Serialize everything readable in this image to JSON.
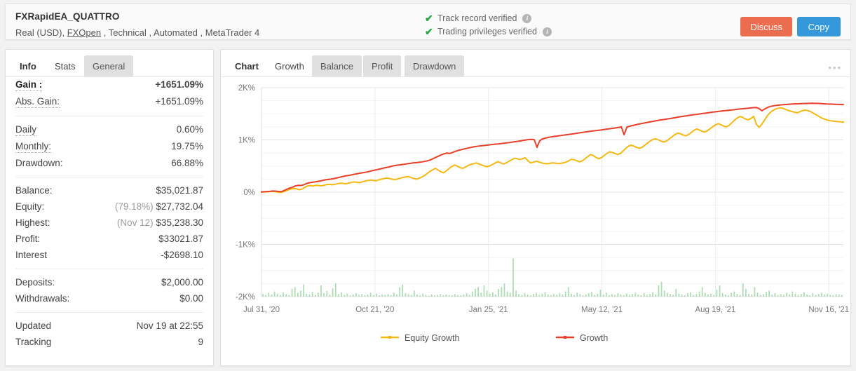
{
  "header": {
    "title": "FXRapidEA_QUATTRO",
    "subtitle_pre": "Real (USD), ",
    "broker_link": "FXOpen",
    "subtitle_post": " , Technical , Automated , MetaTrader 4",
    "verifications": [
      {
        "label": "Track record verified",
        "icon": "check-icon",
        "info": "i"
      },
      {
        "label": "Trading privileges verified",
        "icon": "check-icon",
        "info": "i"
      }
    ],
    "discuss_label": "Discuss",
    "copy_label": "Copy",
    "discuss_color": "#ec6c4f",
    "copy_color": "#3498db"
  },
  "left_panel": {
    "tabs": [
      {
        "label": "Info",
        "state": "plain"
      },
      {
        "label": "Stats",
        "state": "active"
      },
      {
        "label": "General",
        "state": "inactive"
      }
    ],
    "rows": [
      {
        "label": "Gain :",
        "value": "+1651.09%",
        "emphasis": "big",
        "color": "green-b"
      },
      {
        "label": "Abs. Gain:",
        "value": "+1651.09%",
        "emphasis": "",
        "color": "green"
      },
      {
        "label": "Daily",
        "value": "0.60%",
        "emphasis": "",
        "color": ""
      },
      {
        "label": "Monthly:",
        "value": "19.75%",
        "emphasis": "",
        "color": ""
      },
      {
        "label": "Drawdown:",
        "value": "66.88%",
        "emphasis": "",
        "color": ""
      },
      {
        "label": "Balance:",
        "value": "$35,021.87",
        "emphasis": "",
        "color": ""
      },
      {
        "label": "Equity:",
        "value": "$27,732.04",
        "prefix": "(79.18%)",
        "emphasis": "",
        "color": ""
      },
      {
        "label": "Highest:",
        "value": "$35,238.30",
        "prefix": "(Nov 12)",
        "emphasis": "",
        "color": ""
      },
      {
        "label": "Profit:",
        "value": "$33021.87",
        "emphasis": "",
        "color": "green"
      },
      {
        "label": "Interest",
        "value": "-$2698.10",
        "emphasis": "",
        "color": ""
      },
      {
        "label": "Deposits:",
        "value": "$2,000.00",
        "emphasis": "",
        "color": ""
      },
      {
        "label": "Withdrawals:",
        "value": "$0.00",
        "emphasis": "",
        "color": ""
      },
      {
        "label": "Updated",
        "value": "Nov 19 at 22:55",
        "emphasis": "",
        "color": "",
        "nounder": true
      },
      {
        "label": "Tracking",
        "value": "9",
        "emphasis": "",
        "color": "",
        "nounder": true
      }
    ]
  },
  "right_panel": {
    "title": "Chart",
    "tabs": [
      {
        "label": "Growth",
        "state": "active"
      },
      {
        "label": "Balance",
        "state": "inactive"
      },
      {
        "label": "Profit",
        "state": "inactive"
      },
      {
        "label": "Drawdown",
        "state": "inactive"
      }
    ],
    "menu_icon": "•••"
  },
  "chart_data": {
    "type": "line",
    "title": "Growth",
    "xlabel": "",
    "ylabel": "",
    "ylim": [
      -2000,
      2000
    ],
    "ytick_values": [
      2000,
      1000,
      0,
      -1000,
      -2000
    ],
    "ytick_labels": [
      "2K%",
      "1K%",
      "0%",
      "-1K%",
      "-2K%"
    ],
    "minor_gridlines": true,
    "minor_step": 250,
    "xtick_labels": [
      "Jul 31, '20",
      "Oct 21, '20",
      "Jan 25, '21",
      "May 12, '21",
      "Aug 19, '21",
      "Nov 16, '21"
    ],
    "xtick_fracs": [
      0.0,
      0.195,
      0.39,
      0.585,
      0.78,
      0.975
    ],
    "legend_position": "bottom",
    "legend": [
      {
        "name": "Equity Growth",
        "color": "#f5b915"
      },
      {
        "name": "Growth",
        "color": "#e8402a"
      }
    ],
    "series": [
      {
        "name": "Growth",
        "color": "#e8402a",
        "values": [
          5,
          8,
          12,
          16,
          22,
          20,
          14,
          10,
          30,
          55,
          78,
          95,
          118,
          130,
          128,
          140,
          165,
          180,
          190,
          196,
          205,
          215,
          228,
          238,
          245,
          252,
          262,
          275,
          288,
          300,
          312,
          320,
          330,
          342,
          352,
          362,
          372,
          380,
          392,
          405,
          418,
          430,
          442,
          455,
          468,
          478,
          492,
          505,
          515,
          520,
          528,
          536,
          545,
          552,
          560,
          566,
          572,
          578,
          588,
          600,
          615,
          640,
          665,
          690,
          715,
          735,
          748,
          740,
          760,
          782,
          800,
          812,
          826,
          838,
          850,
          862,
          872,
          880,
          886,
          892,
          898,
          905,
          912,
          918,
          922,
          928,
          935,
          942,
          948,
          956,
          964,
          972,
          980,
          990,
          998,
          1006,
          1010,
          1005,
          860,
          985,
          1020,
          1035,
          1048,
          1058,
          1065,
          1072,
          1080,
          1088,
          1095,
          1102,
          1110,
          1118,
          1126,
          1134,
          1142,
          1150,
          1158,
          1166,
          1172,
          1178,
          1185,
          1192,
          1200,
          1208,
          1215,
          1222,
          1230,
          1240,
          1248,
          1100,
          1245,
          1262,
          1275,
          1288,
          1300,
          1312,
          1322,
          1332,
          1342,
          1352,
          1362,
          1372,
          1382,
          1390,
          1398,
          1406,
          1415,
          1425,
          1435,
          1445,
          1452,
          1460,
          1468,
          1476,
          1484,
          1490,
          1498,
          1506,
          1512,
          1520,
          1528,
          1536,
          1542,
          1548,
          1554,
          1560,
          1566,
          1572,
          1578,
          1584,
          1590,
          1596,
          1600,
          1606,
          1612,
          1618,
          1620,
          1600,
          1560,
          1590,
          1620,
          1640,
          1652,
          1660,
          1666,
          1672,
          1676,
          1680,
          1684,
          1688,
          1690,
          1692,
          1694,
          1696,
          1698,
          1700,
          1702,
          1700,
          1698,
          1696,
          1692,
          1688,
          1686,
          1684,
          1682,
          1680,
          1678,
          1676
        ]
      },
      {
        "name": "Equity Growth",
        "color": "#f5b915",
        "values": [
          2,
          4,
          8,
          10,
          14,
          10,
          2,
          -5,
          5,
          28,
          48,
          62,
          70,
          60,
          48,
          62,
          95,
          120,
          126,
          118,
          130,
          128,
          120,
          132,
          146,
          150,
          142,
          150,
          162,
          172,
          168,
          160,
          172,
          186,
          196,
          190,
          182,
          196,
          210,
          222,
          230,
          226,
          218,
          232,
          248,
          260,
          270,
          262,
          250,
          240,
          252,
          268,
          280,
          290,
          300,
          280,
          262,
          250,
          268,
          290,
          320,
          360,
          400,
          430,
          455,
          420,
          390,
          370,
          410,
          455,
          490,
          520,
          500,
          470,
          455,
          480,
          510,
          530,
          545,
          560,
          540,
          520,
          500,
          488,
          505,
          530,
          560,
          585,
          560,
          540,
          560,
          590,
          620,
          650,
          640,
          625,
          640,
          660,
          600,
          560,
          575,
          590,
          580,
          560,
          548,
          545,
          550,
          560,
          555,
          548,
          552,
          560,
          575,
          600,
          630,
          620,
          600,
          580,
          600,
          640,
          680,
          720,
          700,
          665,
          640,
          660,
          700,
          740,
          770,
          760,
          740,
          720,
          740,
          790,
          840,
          880,
          900,
          880,
          855,
          840,
          860,
          900,
          940,
          980,
          1010,
          1020,
          1000,
          975,
          960,
          980,
          1020,
          1060,
          1100,
          1130,
          1120,
          1095,
          1080,
          1100,
          1140,
          1180,
          1210,
          1190,
          1165,
          1150,
          1175,
          1215,
          1255,
          1290,
          1310,
          1290,
          1265,
          1250,
          1280,
          1330,
          1380,
          1420,
          1450,
          1430,
          1400,
          1385,
          1410,
          1450,
          1300,
          1240,
          1300,
          1380,
          1460,
          1520,
          1560,
          1590,
          1605,
          1615,
          1600,
          1580,
          1560,
          1545,
          1530,
          1520,
          1540,
          1560,
          1570,
          1560,
          1540,
          1510,
          1480,
          1450,
          1420,
          1400,
          1380,
          1370,
          1360,
          1355,
          1350,
          1345,
          1340
        ]
      }
    ],
    "volume_series": {
      "name": "volume",
      "color": "#9fd6a6",
      "max_value": 100,
      "values": [
        6,
        4,
        9,
        5,
        12,
        7,
        4,
        10,
        6,
        3,
        18,
        22,
        9,
        14,
        28,
        7,
        5,
        11,
        4,
        9,
        26,
        8,
        13,
        5,
        19,
        31,
        6,
        10,
        4,
        7,
        3,
        5,
        8,
        4,
        6,
        3,
        5,
        9,
        4,
        7,
        3,
        5,
        4,
        6,
        3,
        9,
        5,
        22,
        28,
        8,
        6,
        4,
        14,
        5,
        3,
        7,
        4,
        2,
        5,
        3,
        4,
        6,
        3,
        5,
        4,
        3,
        6,
        4,
        3,
        5,
        8,
        4,
        12,
        18,
        22,
        9,
        26,
        14,
        7,
        10,
        5,
        18,
        22,
        30,
        12,
        9,
        88,
        14,
        6,
        4,
        8,
        5,
        3,
        6,
        9,
        4,
        7,
        10,
        5,
        3,
        6,
        4,
        8,
        5,
        12,
        22,
        7,
        4,
        9,
        6,
        3,
        5,
        8,
        11,
        4,
        7,
        16,
        5,
        9,
        3,
        6,
        4,
        8,
        5,
        3,
        7,
        4,
        6,
        9,
        5,
        3,
        8,
        4,
        6,
        10,
        5,
        26,
        34,
        14,
        9,
        6,
        4,
        18,
        7,
        5,
        3,
        8,
        10,
        4,
        6,
        12,
        22,
        9,
        5,
        7,
        4,
        16,
        26,
        8,
        5,
        3,
        9,
        12,
        6,
        4,
        30,
        18,
        7,
        5,
        22,
        9,
        4,
        6,
        11,
        14,
        5,
        8,
        3,
        6,
        4,
        9,
        5,
        12,
        7,
        4,
        6,
        10,
        5,
        3,
        8,
        4,
        6,
        9,
        5,
        7,
        4,
        3,
        6,
        5,
        4
      ]
    }
  }
}
